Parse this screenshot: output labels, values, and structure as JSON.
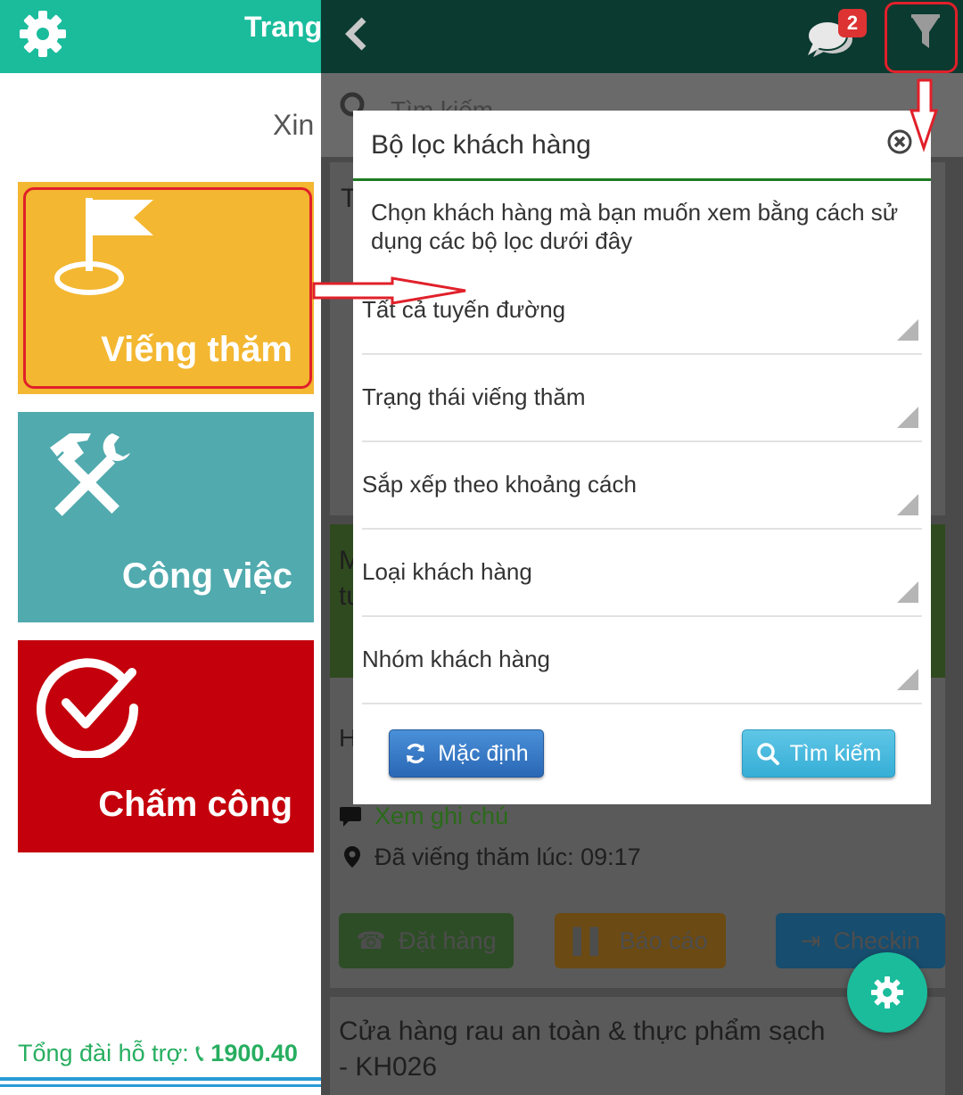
{
  "left_panel": {
    "header_title": "Trang",
    "greeting": "Xin",
    "tiles": [
      {
        "label": "Viếng thăm"
      },
      {
        "label": "Công việc"
      },
      {
        "label": "Chấm công"
      }
    ],
    "support": {
      "label": "Tổng đài hỗ trợ:",
      "phone": "1900.40"
    }
  },
  "right_panel": {
    "chat_badge": "2",
    "search_placeholder": "Tìm kiếm",
    "card1": {
      "title_partial": "T"
    },
    "card2": {
      "title_partial_1": "M",
      "title_partial_2": "tu",
      "address_partial": "H",
      "note_link": "Xem ghi chú",
      "visited": "Đã viếng thăm lúc: 09:17"
    },
    "actions": {
      "order": "Đặt hàng",
      "report": "Báo cáo",
      "checkin": "Checkin"
    },
    "card3": {
      "title": "Cửa hàng rau an toàn & thực phẩm sạch",
      "code": "- KH026"
    }
  },
  "dialog": {
    "title": "Bộ lọc khách hàng",
    "description": "Chọn khách hàng mà bạn muốn xem bằng cách sử dụng các bộ lọc dưới đây",
    "filters": [
      {
        "label": "Tất cả tuyến đường"
      },
      {
        "label": "Trạng thái viếng thăm"
      },
      {
        "label": "Sắp xếp theo khoảng cách"
      },
      {
        "label": "Loại khách hàng"
      },
      {
        "label": "Nhóm khách hàng"
      }
    ],
    "buttons": {
      "default": "Mặc định",
      "search": "Tìm kiếm"
    }
  },
  "colors": {
    "header_teal": "#1abc9c",
    "header_dark": "#0b3a30",
    "tile_visit": "#f3b731",
    "tile_work": "#50aaae",
    "tile_time": "#c4000c",
    "accent_green": "#1e7b22",
    "annotation_red": "#e0202a"
  },
  "icons": [
    "gear-icon",
    "flag-icon",
    "tools-icon",
    "check-circle-icon",
    "chevron-left-icon",
    "chat-icon",
    "filter-icon",
    "search-icon",
    "close-icon",
    "refresh-icon",
    "phone-icon",
    "bar-chart-icon",
    "sign-in-icon",
    "map-marker-icon",
    "comment-icon",
    "home-icon",
    "user-icon"
  ]
}
